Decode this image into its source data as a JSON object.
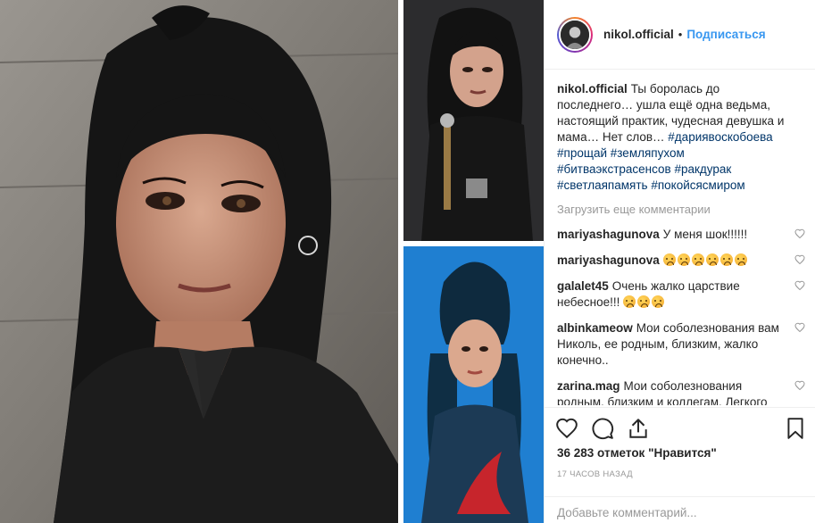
{
  "post": {
    "username": "nikol.official",
    "separator": "•",
    "follow_label": "Подписаться"
  },
  "caption": {
    "username": "nikol.official",
    "text": "Ты боролась до последнего… ушла ещё одна ведьма, настоящий практик, чудесная девушка и мама… Нет слов…",
    "hashtags": [
      "#дариявоскобоева",
      "#прощай",
      "#земляпухом",
      "#битваэкстрасенсов",
      "#ракдурак",
      "#светлаяпамять",
      "#покойсясмиром"
    ]
  },
  "load_more_label": "Загрузить еще комментарии",
  "comments": [
    {
      "username": "mariyashagunova",
      "text": "У меня шок!!!!!!",
      "emoji_count": 0
    },
    {
      "username": "mariyashagunova",
      "text": "",
      "emoji_count": 6
    },
    {
      "username": "galalet45",
      "text": "Очень жалко царствие небесное!!!",
      "emoji_count": 3
    },
    {
      "username": "albinkameow",
      "text": "Мои соболезнования вам Николь, ее родным, близким, жалко конечно..",
      "emoji_count": 0
    },
    {
      "username": "zarina.mag",
      "text": "Мои соболезнования родным, близким и коллегам. Легкого перехода.",
      "emoji_count": 1
    }
  ],
  "likes_text": "36 283 отметок \"Нравится\"",
  "time_text": "17 часов назад",
  "add_comment_placeholder": "Добавьте комментарий...",
  "icons": {
    "like": "heart-icon",
    "comment": "comment-bubble-icon",
    "share": "share-icon",
    "save": "bookmark-icon",
    "comment_like": "heart-small-icon"
  },
  "colors": {
    "link_blue": "#3897f0",
    "hashtag": "#003569",
    "muted": "#999999",
    "text": "#262626"
  }
}
